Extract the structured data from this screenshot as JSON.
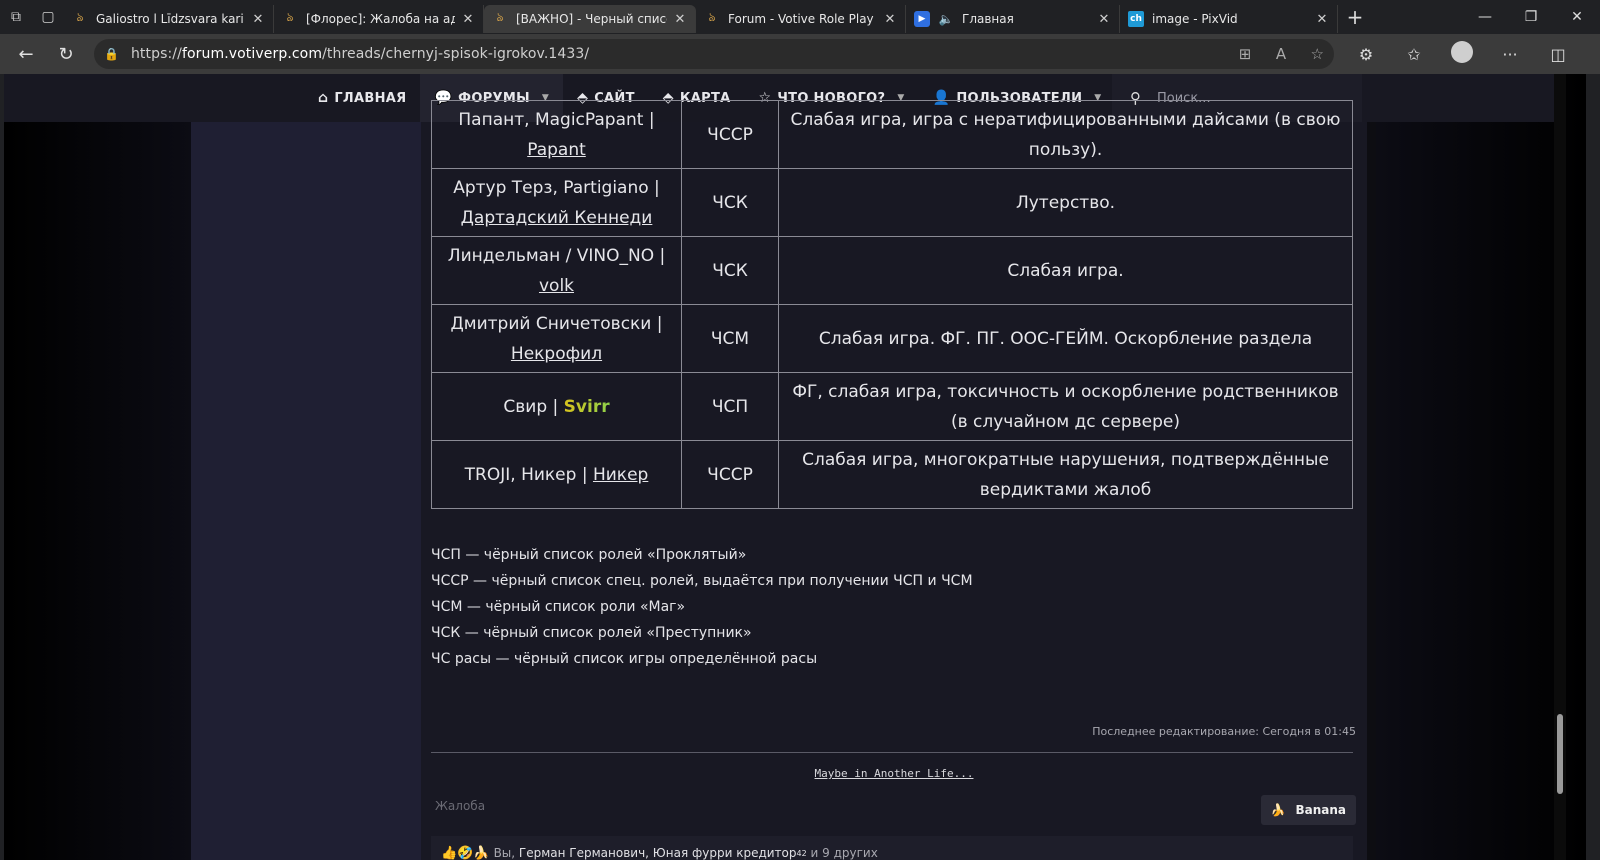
{
  "browser": {
    "tabs": [
      {
        "title": "Galiostro l Līdzsvara kari | Стр",
        "icon": "votive-logo-icon",
        "active": false
      },
      {
        "title": "[Флорес]: Жалоба на админ",
        "icon": "votive-logo-icon",
        "active": false
      },
      {
        "title": "[ВАЖНО] - Черный список и",
        "icon": "votive-logo-icon",
        "active": true
      },
      {
        "title": "Forum - Votive Role Play",
        "icon": "votive-logo-icon",
        "active": false
      },
      {
        "title": "Главная",
        "icon": "video-play-icon",
        "active": false
      },
      {
        "title": "image - PixVid",
        "icon": "ch-logo-icon",
        "active": false
      }
    ],
    "url_prefix": "https://",
    "url_domain": "forum.votiverp.com",
    "url_path": "/threads/chernyj-spisok-igrokov.1433/"
  },
  "nav": {
    "items": [
      {
        "label": "ГЛАВНАЯ",
        "icon": "home-icon",
        "dropdown": false,
        "active": false
      },
      {
        "label": "ФОРУМЫ",
        "icon": "chat-bubbles-icon",
        "dropdown": true,
        "active": true
      },
      {
        "label": "САЙТ",
        "icon": "tag-icon",
        "dropdown": false,
        "active": false
      },
      {
        "label": "КАРТА",
        "icon": "tag-icon",
        "dropdown": false,
        "active": false
      },
      {
        "label": "ЧТО НОВОГО?",
        "icon": "star-icon",
        "dropdown": true,
        "active": false
      },
      {
        "label": "ПОЛЬЗОВАТЕЛИ",
        "icon": "user-icon",
        "dropdown": true,
        "active": false
      }
    ],
    "search_placeholder": "Поиск..."
  },
  "table": {
    "rows": [
      {
        "name": "Папант, MagicPapant |",
        "link": "Papant",
        "list": "ЧССР",
        "reason": "Слабая игра, игра с нератифицированными дайсами (в свою пользу)."
      },
      {
        "name": "Артур Терз, Partigiano |",
        "link": "Дартадский Кеннеди",
        "list": "ЧСК",
        "reason": "Лутерство."
      },
      {
        "name": "Линдельман / VINO_NO |",
        "link": "volk",
        "list": "ЧСК",
        "reason": "Слабая игра."
      },
      {
        "name": "Дмитрий Сничетовски |",
        "link": "Некрофил",
        "list": "ЧСМ",
        "reason": "Слабая игра. ФГ. ПГ. ООС-ГЕЙМ. Оскорбление раздела"
      },
      {
        "name": "Свир |",
        "link": "Svirr",
        "list": "ЧСП",
        "reason": "ФГ, слабая игра, токсичность и оскорбление родственников (в случайном дс сервере)"
      },
      {
        "name": "TROJI, Никер |",
        "link": "Никер",
        "list": "ЧССР",
        "reason": "Слабая игра, многократные нарушения, подтверждённые вердиктами жалоб"
      }
    ]
  },
  "legend": [
    "ЧСП — чёрный список ролей «Проклятый»",
    "ЧССР — чёрный список спец. ролей, выдаётся при получении ЧСП и ЧСМ",
    "ЧСМ — чёрный список роли «Маг»",
    "ЧСК — чёрный список ролей «Преступник»",
    "ЧС расы — чёрный список игры определённой расы"
  ],
  "post": {
    "edited": "Последнее редактирование: Сегодня в 01:45",
    "signature": "Maybe in Another Life...",
    "report_label": "Жалоба",
    "reaction_button": "Banana",
    "reactions_you": "Вы,",
    "reactions_names": "Герман Германович, Юная фурри кредитор",
    "reactions_sup": "42",
    "reactions_others": "и 9 других"
  },
  "colors": {
    "nav_bg": "#181822",
    "content_bg": "#181823",
    "sidebar_bg": "#1f1f33",
    "svirr_gradient": "#d7c21e"
  }
}
